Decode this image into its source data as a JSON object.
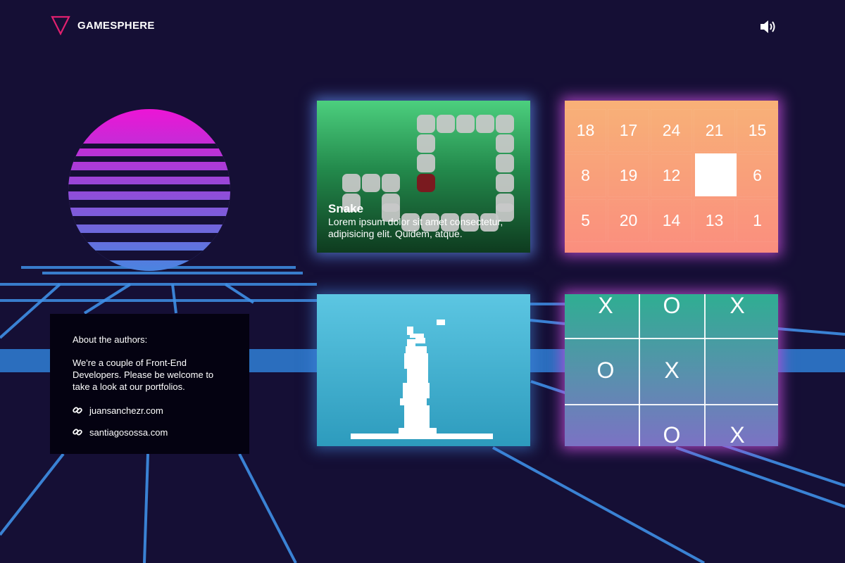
{
  "app": {
    "name": "GAMESPHERE",
    "accent_color": "#e0206f",
    "logo_icon": "triangle-down-icon",
    "sound_icon": "speaker-icon"
  },
  "about": {
    "title": "About the authors:",
    "text": "We're a couple of Front-End Developers. Please be welcome to take a look at our portfolios.",
    "link_icon": "link-icon",
    "links": [
      {
        "label": "juansanchezr.com"
      },
      {
        "label": "santiagosossa.com"
      }
    ]
  },
  "cards": {
    "snake": {
      "title": "Snake",
      "description": "Lorem ipsum dolor sit amet consectetur, adipisicing elit. Quidem, atque.",
      "color_top": "#4ccf7e",
      "color_bottom": "#0e3b1f",
      "snake_color": "#c8c8c8",
      "food_color": "#7a1a1f"
    },
    "puzzle": {
      "rows": [
        [
          "18",
          "17",
          "24",
          "21",
          "15"
        ],
        [
          "8",
          "19",
          "12",
          "",
          "6"
        ],
        [
          "5",
          "20",
          "14",
          "13",
          "1"
        ]
      ]
    },
    "jump": {
      "color_top": "#5cc6e2",
      "color_bottom": "#2d9bbd"
    },
    "tictactoe": {
      "board": [
        [
          "X",
          "O",
          "X"
        ],
        [
          "O",
          "X",
          ""
        ],
        [
          "",
          "O",
          "X"
        ]
      ]
    }
  }
}
